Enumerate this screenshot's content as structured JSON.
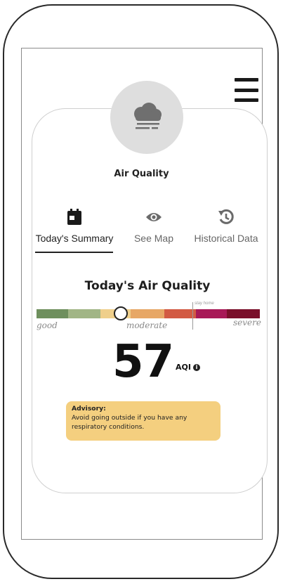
{
  "header": {
    "title": "Air Quality",
    "icon": "cloud-fog-icon",
    "menu_icon": "hamburger-menu-icon"
  },
  "tabs": [
    {
      "label": "Today's Summary",
      "icon": "calendar-icon",
      "active": true
    },
    {
      "label": "See Map",
      "icon": "eye-icon",
      "active": false
    },
    {
      "label": "Historical Data",
      "icon": "history-icon",
      "active": false
    }
  ],
  "summary": {
    "title": "Today's Air Quality",
    "scale": {
      "labels": {
        "good": "good",
        "moderate": "moderate",
        "severe": "severe",
        "stay_home": "stay home"
      },
      "colors": [
        "#6e8f5d",
        "#a1b585",
        "#efcf8b",
        "#e7a766",
        "#d25a43",
        "#a81957",
        "#7a0f2a"
      ],
      "current_level": 57
    },
    "aqi_value": "57",
    "aqi_unit": "AQI",
    "info_icon": "i"
  },
  "advisory": {
    "heading": "Advisory:",
    "text": "Avoid going outside if you have any respiratory conditions."
  },
  "colors": {
    "accent_advisory": "#f4cf7f",
    "circle_bg": "#dedede"
  }
}
